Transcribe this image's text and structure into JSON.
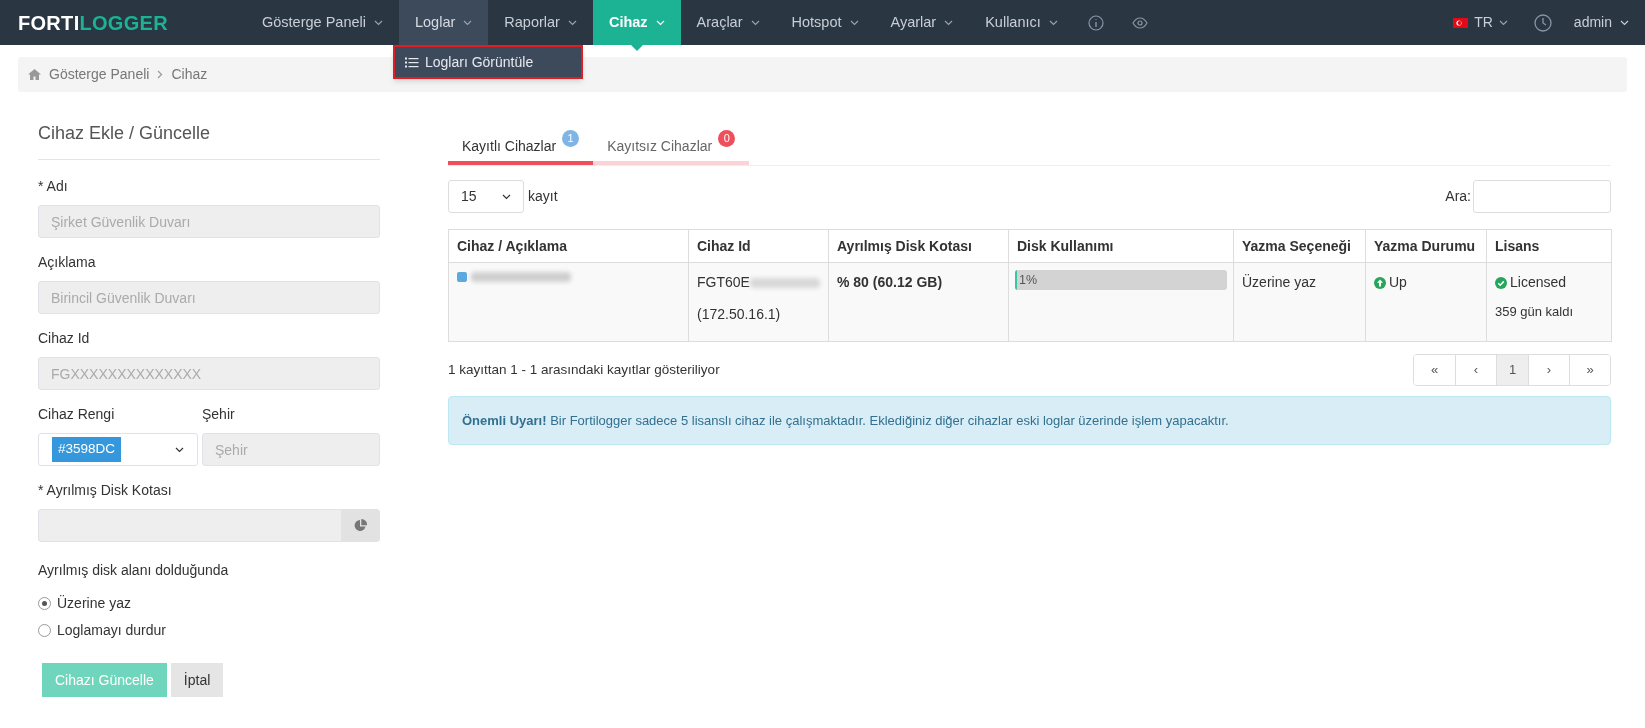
{
  "brand": {
    "first": "FORTI",
    "second": "LOGGER"
  },
  "nav": [
    {
      "kind": "text",
      "label": "Gösterge Paneli",
      "selected": false,
      "expanded": false
    },
    {
      "kind": "text",
      "label": "Loglar",
      "selected": false,
      "expanded": true
    },
    {
      "kind": "text",
      "label": "Raporlar",
      "selected": false,
      "expanded": false
    },
    {
      "kind": "text",
      "label": "Cihaz",
      "selected": true,
      "expanded": false
    },
    {
      "kind": "text",
      "label": "Araçlar",
      "selected": false,
      "expanded": false
    },
    {
      "kind": "text",
      "label": "Hotspot",
      "selected": false,
      "expanded": false
    },
    {
      "kind": "text",
      "label": "Ayarlar",
      "selected": false,
      "expanded": false
    },
    {
      "kind": "text",
      "label": "Kullanıcı",
      "selected": false,
      "expanded": false
    },
    {
      "kind": "info",
      "selected": false,
      "expanded": false
    },
    {
      "kind": "eye",
      "selected": false,
      "expanded": false
    }
  ],
  "dropdown": {
    "items": [
      {
        "label": "Logları Görüntüle",
        "highlighted": true
      }
    ]
  },
  "language": "TR",
  "user": "admin",
  "breadcrumb": [
    "Gösterge Paneli",
    "Cihaz"
  ],
  "form": {
    "title": "Cihaz Ekle / Güncelle",
    "name": {
      "label": "* Adı",
      "placeholder": "Şirket Güvenlik Duvarı"
    },
    "description": {
      "label": "Açıklama",
      "placeholder": "Birincil Güvenlik Duvarı"
    },
    "device_id": {
      "label": "Cihaz Id",
      "placeholder": "FGXXXXXXXXXXXXXX"
    },
    "color": {
      "label": "Cihaz Rengi",
      "value": "#3598DC",
      "color": "#3598dc"
    },
    "city": {
      "label": "Şehir",
      "placeholder": "Şehir"
    },
    "quota": {
      "label": "* Ayrılmış Disk Kotası"
    },
    "when_full": {
      "label": "Ayrılmış disk alanı dolduğunda",
      "options": [
        {
          "label": "Üzerine yaz",
          "selected": true
        },
        {
          "label": "Loglamayı durdur",
          "selected": false
        }
      ]
    },
    "buttons": [
      {
        "kind": "primary",
        "label": "Cihazı Güncelle"
      },
      {
        "kind": "default",
        "label": "İptal"
      }
    ]
  },
  "tabs": [
    {
      "label": "Kayıtlı Cihazlar",
      "selected": true,
      "badge": "1",
      "color": "#7fb5e6"
    },
    {
      "label": "Kayıtsız Cihazlar",
      "selected": false,
      "badge": "0",
      "color": "#ef4f5a"
    }
  ],
  "page_length": {
    "value": "15",
    "label": "kayıt"
  },
  "search": {
    "label": "Ara:"
  },
  "table": {
    "columns": [
      "Cihaz / Açıklama",
      "Cihaz Id",
      "Ayrılmış Disk Kotası",
      "Disk Kullanımı",
      "Yazma Seçeneği",
      "Yazma Durumu",
      "Lisans"
    ],
    "rows": [
      {
        "color": "#5da9dd",
        "device_id": "FGT60E",
        "ip": "(172.50.16.1)",
        "quota": "% 80 (60.12 GB)",
        "usage": {
          "level": 0.01,
          "reading": "1%"
        },
        "write_option": "Üzerine yaz",
        "status": "Up",
        "license": "Licensed",
        "days_left": "359 gün kaldı"
      }
    ]
  },
  "info": "1 kayıttan 1 - 1 arasındaki kayıtlar gösteriliyor",
  "pagination": [
    {
      "label": "«",
      "selected": false
    },
    {
      "label": "‹",
      "selected": false
    },
    {
      "label": "1",
      "selected": true
    },
    {
      "label": "›",
      "selected": false
    },
    {
      "label": "»",
      "selected": false
    }
  ],
  "alert": "**Önemli Uyarı!** Bir Fortilogger sadece 5 lisanslı cihaz ile çalışmaktadır. Eklediğiniz diğer cihazlar eski loglar üzerinde işlem yapacaktır."
}
